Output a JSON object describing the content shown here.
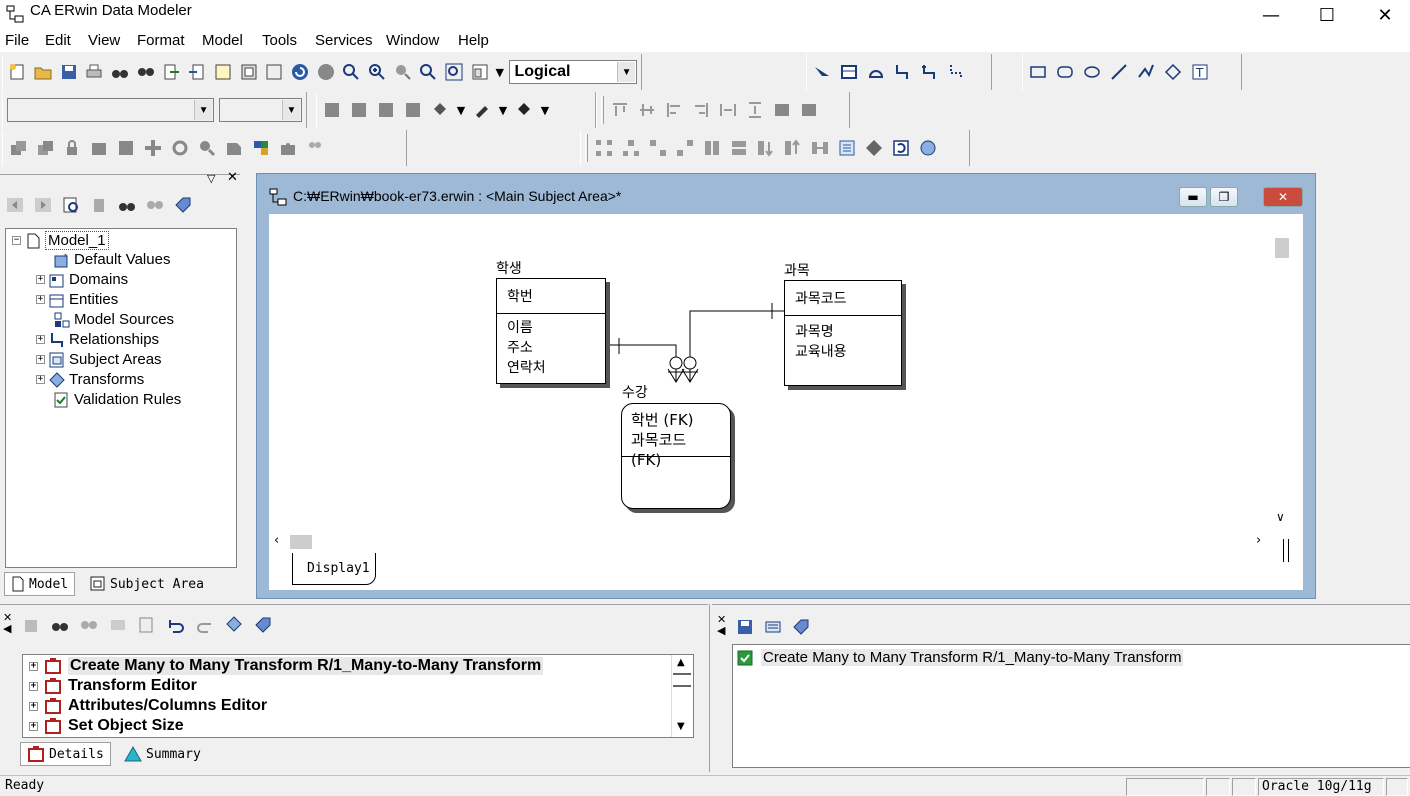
{
  "window": {
    "title": "CA ERwin Data Modeler"
  },
  "menu": [
    "File",
    "Edit",
    "View",
    "Format",
    "Model",
    "Tools",
    "Services",
    "Window",
    "Help"
  ],
  "toolbar": {
    "view_mode": "Logical"
  },
  "explorer": {
    "tree": {
      "root": "Model_1",
      "items": [
        "Default Values",
        "Domains",
        "Entities",
        "Model Sources",
        "Relationships",
        "Subject Areas",
        "Transforms",
        "Validation Rules"
      ]
    },
    "tabs": [
      "Model",
      "Subject Area"
    ]
  },
  "diagram_window": {
    "title": "C:₩ERwin₩book-er73.erwin : <Main Subject Area>*",
    "tab": "Display1",
    "entities": [
      {
        "name": "학생",
        "pk": [
          "학번"
        ],
        "attrs": [
          "이름",
          "주소",
          "연락처"
        ]
      },
      {
        "name": "과목",
        "pk": [
          "과목코드"
        ],
        "attrs": [
          "과목명",
          "교육내용"
        ]
      },
      {
        "name": "수강",
        "pk": [
          "학번 (FK)",
          "과목코드 (FK)"
        ],
        "attrs": []
      }
    ]
  },
  "action_log": {
    "items": [
      "Create Many to Many Transform R/1_Many-to-Many Transform",
      "Transform Editor",
      "Attributes/Columns Editor",
      "Set Object Size"
    ],
    "tabs": [
      "Details",
      "Summary"
    ]
  },
  "summary_pane": {
    "item": "Create Many to Many Transform R/1_Many-to-Many Transform"
  },
  "status": {
    "left": "Ready",
    "db": "Oracle 10g/11g"
  },
  "colors": {
    "mdi_frame": "#9db9d6",
    "close_button": "#c94c3c"
  }
}
